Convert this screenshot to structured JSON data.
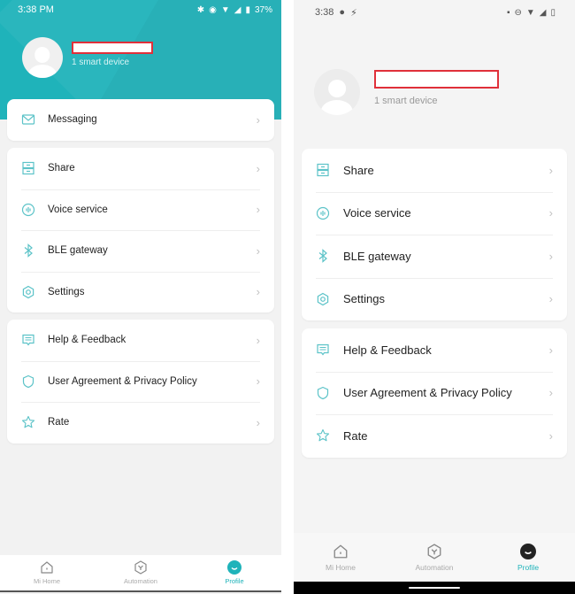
{
  "colors": {
    "accent": "#1fb3ba",
    "icon": "#5cc3c8",
    "redaction_border": "#e0303a"
  },
  "left_screen": {
    "status_bar": {
      "time": "3:38 PM",
      "battery": "37%",
      "icons": [
        "bluetooth-icon",
        "eye-icon",
        "wifi-icon",
        "signal-icon",
        "battery-icon"
      ]
    },
    "profile": {
      "name": "",
      "device_count": "1 smart device"
    },
    "groups": [
      [
        {
          "icon": "mail-icon",
          "label": "Messaging"
        }
      ],
      [
        {
          "icon": "share-icon",
          "label": "Share"
        },
        {
          "icon": "voice-icon",
          "label": "Voice service"
        },
        {
          "icon": "bluetooth-icon",
          "label": "BLE gateway"
        },
        {
          "icon": "settings-icon",
          "label": "Settings"
        }
      ],
      [
        {
          "icon": "feedback-icon",
          "label": "Help & Feedback"
        },
        {
          "icon": "shield-icon",
          "label": "User Agreement & Privacy Policy"
        },
        {
          "icon": "star-icon",
          "label": "Rate"
        }
      ]
    ],
    "tabs": [
      {
        "icon": "home-icon",
        "label": "Mi Home",
        "active": false
      },
      {
        "icon": "automation-icon",
        "label": "Automation",
        "active": false
      },
      {
        "icon": "profile-icon",
        "label": "Profile",
        "active": true
      }
    ]
  },
  "right_screen": {
    "status_bar": {
      "time": "3:38",
      "icons_left": [
        "pocket-casts-icon",
        "flash-icon"
      ],
      "icons_right": [
        "vibrate-icon",
        "dnd-icon",
        "wifi-icon",
        "signal-icon",
        "battery-icon"
      ]
    },
    "profile": {
      "name": "",
      "device_count": "1 smart device"
    },
    "groups": [
      [
        {
          "icon": "share-icon",
          "label": "Share"
        },
        {
          "icon": "voice-icon",
          "label": "Voice service"
        },
        {
          "icon": "bluetooth-icon",
          "label": "BLE gateway"
        },
        {
          "icon": "settings-icon",
          "label": "Settings"
        }
      ],
      [
        {
          "icon": "feedback-icon",
          "label": "Help & Feedback"
        },
        {
          "icon": "shield-icon",
          "label": "User Agreement & Privacy Policy"
        },
        {
          "icon": "star-icon",
          "label": "Rate"
        }
      ]
    ],
    "tabs": [
      {
        "icon": "home-icon",
        "label": "Mi Home",
        "active": false
      },
      {
        "icon": "automation-icon",
        "label": "Automation",
        "active": false
      },
      {
        "icon": "profile-icon",
        "label": "Profile",
        "active": true
      }
    ]
  }
}
